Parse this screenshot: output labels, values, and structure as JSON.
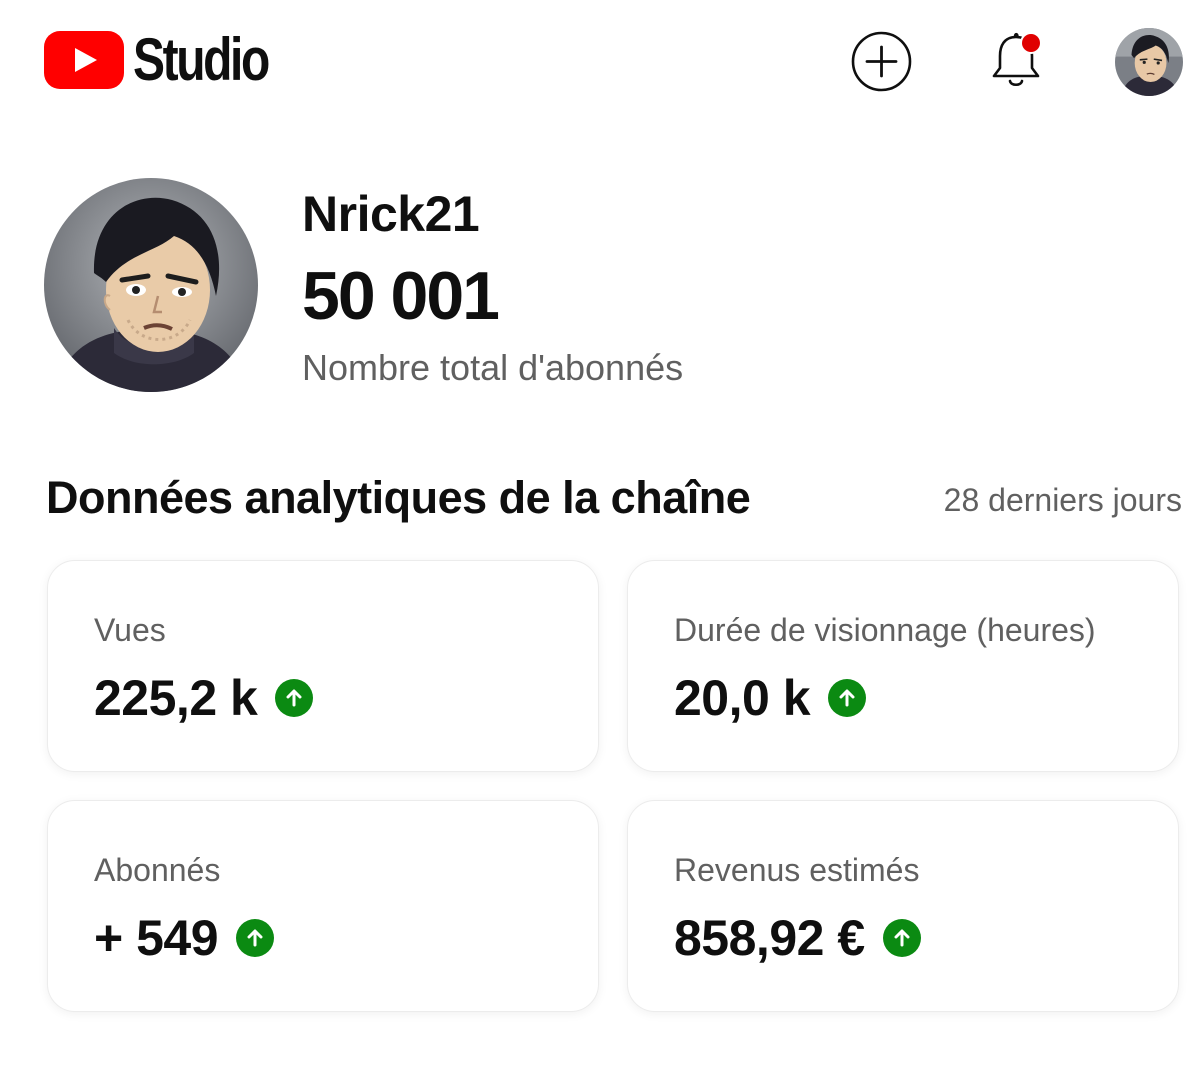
{
  "header": {
    "logo_text": "Studio",
    "icons": [
      "youtube-logo-icon",
      "create-plus-icon",
      "notification-bell-icon",
      "account-avatar"
    ],
    "notification_dot_color": "#ff0000"
  },
  "profile": {
    "channel_name": "Nrick21",
    "subscriber_count": "50 001",
    "subscriber_label": "Nombre total d'abonnés"
  },
  "analytics": {
    "title": "Données analytiques de la chaîne",
    "period": "28 derniers jours",
    "cards": [
      {
        "label": "Vues",
        "value": "225,2 k",
        "trend": "up"
      },
      {
        "label": "Durée de visionnage (heures)",
        "value": "20,0 k",
        "trend": "up"
      },
      {
        "label": "Abonnés",
        "value": "+ 549",
        "trend": "up"
      },
      {
        "label": "Revenus estimés",
        "value": "858,92 €",
        "trend": "up"
      }
    ],
    "trend_up_color": "#0b8a12"
  },
  "colors": {
    "brand_red": "#ff0000",
    "text_primary": "#0f0f0f",
    "text_secondary": "#606060"
  }
}
